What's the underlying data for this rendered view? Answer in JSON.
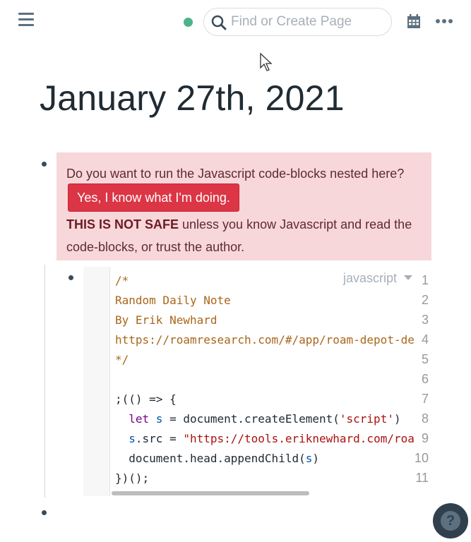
{
  "topbar": {
    "search_placeholder": "Find or Create Page",
    "sync_status_color": "#4db38a",
    "icons": [
      "menu-icon",
      "sync-status-icon",
      "search-icon",
      "calendar-icon",
      "more-icon"
    ]
  },
  "page": {
    "title": "January 27th, 2021"
  },
  "warning": {
    "text_before": "Do you want to run the Javascript code-blocks nested here?",
    "button_label": "Yes, I know what I'm doing.",
    "bold_text": "THIS IS NOT SAFE",
    "text_after": " unless you know Javascript and read the code-blocks, or trust the author."
  },
  "code_block": {
    "language": "javascript",
    "line_numbers": [
      "1",
      "2",
      "3",
      "4",
      "5",
      "6",
      "7",
      "8",
      "9",
      "10",
      "11"
    ],
    "lines": [
      "/*",
      "Random Daily Note",
      "By Erik Newhard",
      "https://roamresearch.com/#/app/roam-depot-de",
      "*/",
      "",
      ";(() => {",
      "  let s = document.createElement('script')",
      "  s.src = \"https://tools.eriknewhard.com/roa",
      "  document.head.appendChild(s)",
      "})();"
    ],
    "tokens": {
      "l8_kw": "let",
      "l8_var": " s",
      "l8_mid": " = document.createElement(",
      "l8_str": "'script'",
      "l8_end": ")",
      "l9_var": "s",
      "l9_mid": ".src = ",
      "l9_str": "\"https://tools.eriknewhard.com/roa",
      "l10_start": "  document.head.appendChild(",
      "l10_var": "s",
      "l10_end": ")"
    }
  },
  "help_button": {
    "label": "?"
  }
}
